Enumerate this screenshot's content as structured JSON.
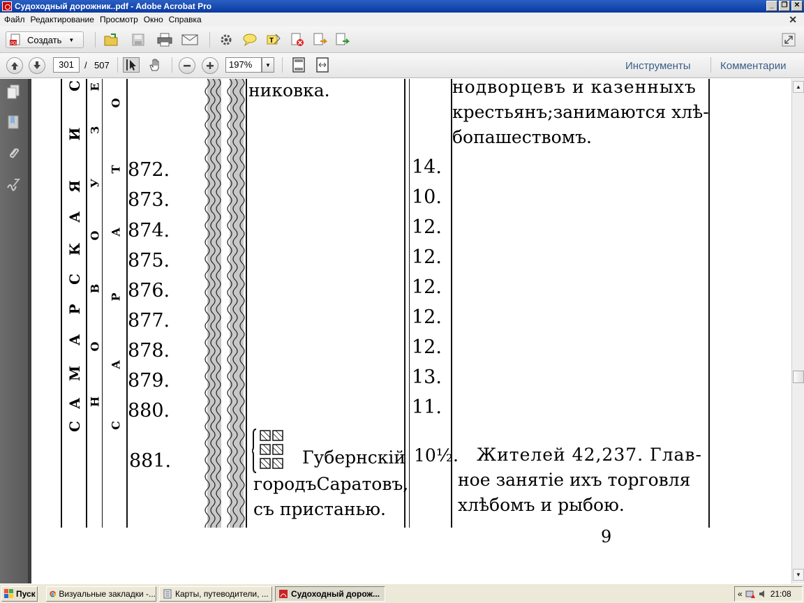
{
  "window": {
    "title": "Судоходный дорожник..pdf - Adobe Acrobat Pro",
    "minimize": "_",
    "restore": "❐",
    "close": "✕"
  },
  "menu": {
    "items": [
      "Файл",
      "Редактирование",
      "Просмотр",
      "Окно",
      "Справка"
    ],
    "close_glyph": "✕"
  },
  "toolbar": {
    "create_label": "Создать"
  },
  "nav": {
    "current_page": "301",
    "page_separator": "/",
    "total_pages": "507",
    "zoom": "197%",
    "tools_link": "Инструменты",
    "comments_link": "Комментарии"
  },
  "document": {
    "vertical_samarskaya": [
      "С",
      "А",
      "М",
      "А",
      "Р",
      "С",
      "К",
      "А",
      "Я",
      "",
      "И"
    ],
    "vertical_novouzensk": [
      "Н",
      "О",
      "В",
      "О",
      "У",
      "З",
      "Е"
    ],
    "vertical_saratov": [
      "С",
      "А",
      "Р",
      "А",
      "Т",
      "О"
    ],
    "top_left_text": "никовка.",
    "top_right_lines": [
      "нодворцевъ и казенныхъ",
      "крестьянъ;занимаются хлѣ-",
      "бопашествомъ."
    ],
    "rows": [
      {
        "num": "872.",
        "dist": "14."
      },
      {
        "num": "873.",
        "dist": "10."
      },
      {
        "num": "874.",
        "dist": "12."
      },
      {
        "num": "875.",
        "dist": "12."
      },
      {
        "num": "876.",
        "dist": "12."
      },
      {
        "num": "877.",
        "dist": "12."
      },
      {
        "num": "878.",
        "dist": "12."
      },
      {
        "num": "879.",
        "dist": "13."
      },
      {
        "num": "880.",
        "dist": "11."
      }
    ],
    "last_row": {
      "num": "881.",
      "dist": "10½.",
      "place_lines": [
        "Губернскій",
        "городъСаратовъ,",
        "съ пристанью."
      ],
      "desc_lines": [
        "Жителей 42,237. Глав-",
        "ное занятіе ихъ торговля",
        "хлѣбомъ и рыбою."
      ]
    },
    "page_number": "9"
  },
  "taskbar": {
    "start_label": "Пуск",
    "tasks": [
      {
        "label": "Визуальные закладки -..."
      },
      {
        "label": "Карты, путеводители, ..."
      },
      {
        "label": "Судоходный дорож..."
      }
    ],
    "tray_chevron": "«",
    "clock": "21:08"
  }
}
